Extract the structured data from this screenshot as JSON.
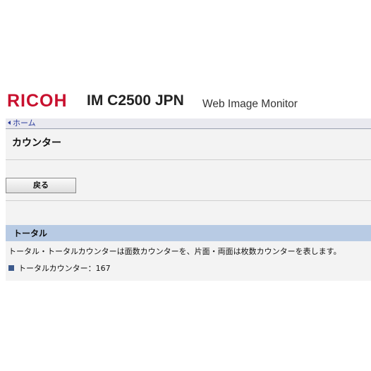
{
  "header": {
    "brand": "RICOH",
    "model": "IM C2500 JPN",
    "product": "Web Image Monitor"
  },
  "nav": {
    "home_label": "ホーム"
  },
  "main": {
    "title": "カウンター",
    "back_label": "戻る",
    "section": {
      "title": "トータル",
      "description": "トータル・トータルカウンターは面数カウンターを、片面・両面は枚数カウンターを表します。",
      "counter_label": "トータルカウンター",
      "counter_separator": "：",
      "counter_value": "167"
    }
  },
  "colors": {
    "brand_red": "#c8102e",
    "section_header_bg": "#b8cbe4",
    "link_blue": "#2a3b9c",
    "bullet_blue": "#3d5a8c"
  },
  "icons": {
    "home_arrow": "triangle-left-icon",
    "bullet": "square-bullet-icon"
  }
}
